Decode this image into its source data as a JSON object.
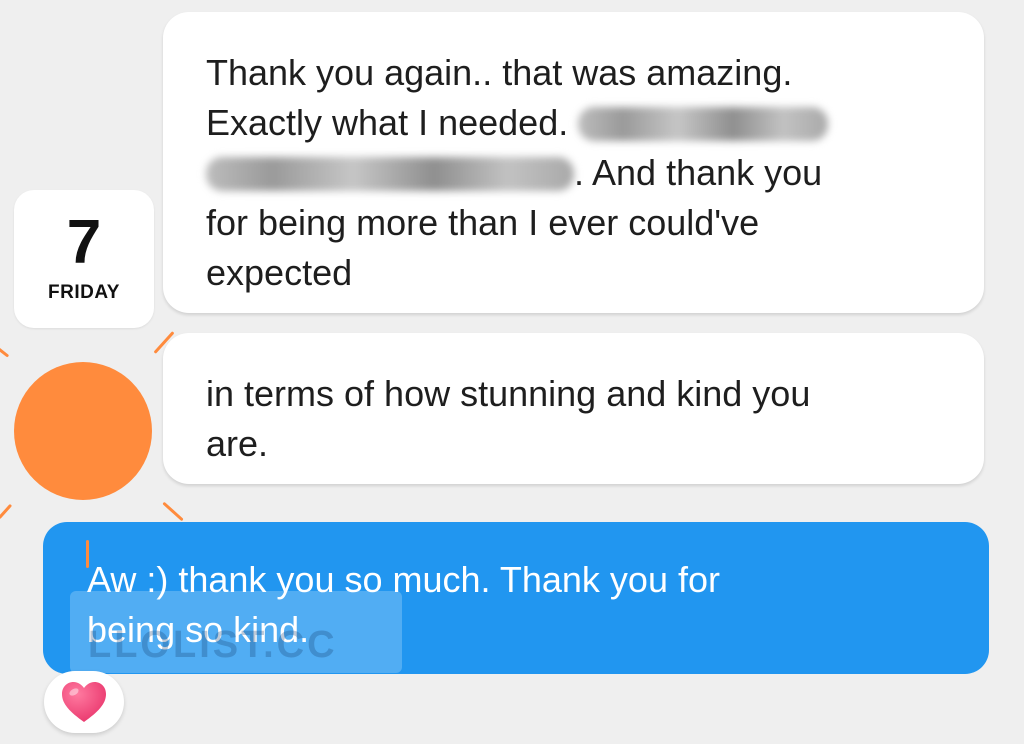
{
  "date_badge": {
    "day": "7",
    "weekday": "FRIDAY"
  },
  "messages": [
    {
      "direction": "incoming",
      "lines": {
        "l1": "Thank you again.. that was amazing.",
        "l2": "Exactly what I needed.",
        "l3": ". And thank you",
        "l4": "for being more than I ever could've",
        "l5": "expected"
      }
    },
    {
      "direction": "incoming",
      "lines": {
        "l1": "in terms of how stunning and kind you",
        "l2": "are."
      }
    },
    {
      "direction": "outgoing",
      "lines": {
        "l1": "Aw :) thank you so much. Thank you for",
        "l2": "being so kind."
      }
    }
  ],
  "reaction": {
    "icon": "heart-icon"
  },
  "watermark": {
    "text": "LLOLIST.CC"
  },
  "colors": {
    "background": "#efefef",
    "incoming_bubble": "#ffffff",
    "outgoing_bubble": "#2196f0",
    "sun": "#ff8b3d",
    "heart": "#e8336a"
  }
}
